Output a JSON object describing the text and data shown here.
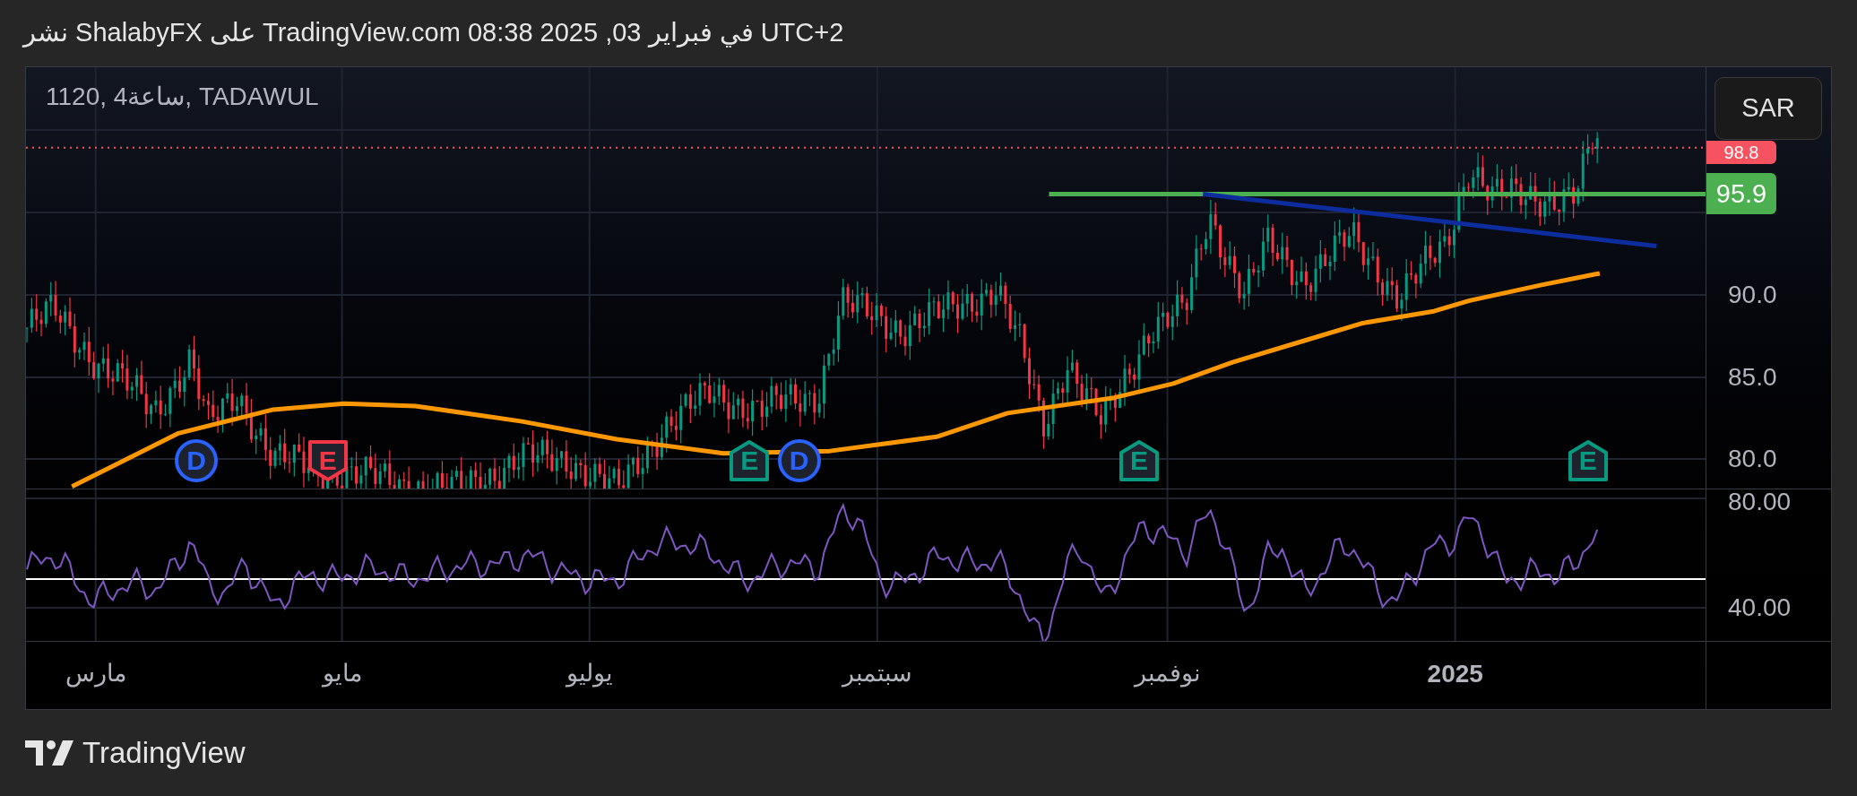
{
  "header": {
    "text": "نشر ShalabyFX على TradingView.com في فبراير 03, 2025 08:38 UTC+2"
  },
  "chart": {
    "symbol": "1120, 4ساعة, TADAWUL",
    "currency_button": "SAR",
    "price_labels": [
      {
        "kind": "last",
        "text": "98.8",
        "color": "#f7525f"
      },
      {
        "kind": "line",
        "text": "95.9",
        "color": "#4caf50"
      }
    ],
    "price_ticks": [
      "90.0",
      "85.0",
      "80.0"
    ],
    "markers": [
      {
        "kind": "beat",
        "letter": "E",
        "color": "#089981"
      },
      {
        "kind": "beat",
        "letter": "E",
        "color": "#089981"
      },
      {
        "kind": "dividend",
        "letter": "D",
        "color": "#2962ff"
      },
      {
        "kind": "beat",
        "letter": "E",
        "color": "#089981"
      },
      {
        "kind": "miss",
        "letter": "E",
        "color": "#f23645"
      },
      {
        "kind": "dividend",
        "letter": "D",
        "color": "#2962ff"
      }
    ],
    "rsi_ticks": [
      "80.00",
      "40.00"
    ],
    "time_labels": [
      {
        "text": "2025",
        "bold": true
      },
      {
        "text": "نوفمبر",
        "bold": false
      },
      {
        "text": "سبتمبر",
        "bold": false
      },
      {
        "text": "يوليو",
        "bold": false
      },
      {
        "text": "مايو",
        "bold": false
      },
      {
        "text": "مارس",
        "bold": false
      }
    ]
  },
  "footer": {
    "brand": "TradingView"
  }
}
